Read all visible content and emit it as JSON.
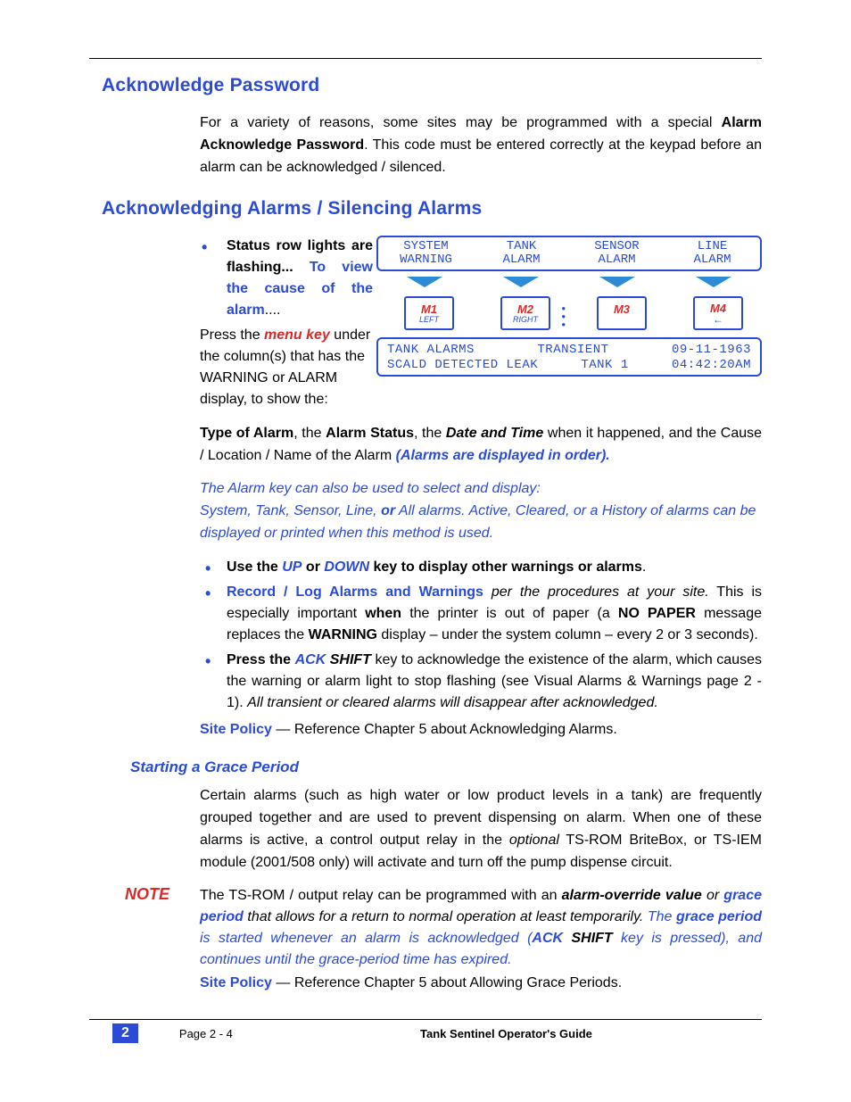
{
  "headings": {
    "h1a": "Acknowledge Password",
    "h1b": "Acknowledging Alarms / Silencing Alarms",
    "h3": "Starting a Grace Period"
  },
  "ack_password": {
    "p1_a": "For a variety of reasons, some sites may be programmed with a special ",
    "p1_b": "Alarm Acknowledge Password",
    "p1_c": ". This code must be entered correctly at the keypad before an alarm can be acknowledged / silenced."
  },
  "bullets1": {
    "b1_a": "Status row lights are flashing... ",
    "b1_b": "To view the cause of the alarm",
    "b1_c": "....",
    "tail_a": "Press the ",
    "tail_b": "menu key",
    "tail_c": " under the column(s) that has the WARNING or ALARM display, to show the:"
  },
  "keypad": {
    "status": [
      "SYSTEM WARNING",
      "TANK ALARM",
      "SENSOR ALARM",
      "LINE ALARM"
    ],
    "keys": [
      {
        "top": "M1",
        "sub": "LEFT"
      },
      {
        "top": "M2",
        "sub": "RIGHT"
      },
      {
        "top": "M3",
        "sub": ""
      },
      {
        "top": "M4",
        "sub": "←"
      }
    ],
    "lcd": {
      "l1a": "TANK ALARMS",
      "l1b": "TRANSIENT",
      "l1c": "09-11-1963",
      "l2a": "SCALD DETECTED LEAK",
      "l2b": "TANK 1",
      "l2c": "04:42:20AM"
    }
  },
  "after_keypad": {
    "p_a": "Type of Alarm",
    "p_b": ", the ",
    "p_c": "Alarm Status",
    "p_d": ", the ",
    "p_e": "Date and Time",
    "p_f": " when it happened, and the Cause / Location / Name of the Alarm ",
    "p_g": "(Alarms are displayed in order)."
  },
  "ital_note": {
    "l1": "The Alarm key can also be used to select and display:",
    "l2_a": "System, Tank, Sensor, Line, ",
    "l2_or": "or",
    "l2_b": " All alarms.  Active, Cleared, or a History of alarms can be displayed or printed when this method is used."
  },
  "bullets2": [
    {
      "a": "Use the ",
      "key1": "UP",
      "mid": " or ",
      "key2": "DOWN",
      "b": " key to display other warnings or alarms",
      "tail": "."
    },
    {
      "a": "Record / Log Alarms and Warnings",
      "b": " per the procedures at your site.",
      "c": "  This is especially important ",
      "w": "when",
      "d": " the printer is out of paper (a ",
      "np": "NO PAPER",
      "e": " message replaces the ",
      "warn": "WARNING",
      "f": " display – under the system column – every 2 or 3 seconds)."
    },
    {
      "a": "Press the ",
      "ack": "ACK",
      "shift": " SHIFT",
      "b": " key to acknowledge the existence of the alarm, which causes the warning or alarm light to stop flashing (see Visual Alarms & Warnings page 2 - 1). ",
      "c": "All transient or cleared alarms will disappear after acknowledged."
    }
  ],
  "site_policy1": {
    "lbl": "Site Policy",
    "body": " — Reference Chapter 5 about Acknowledging Alarms."
  },
  "grace": {
    "p": "Certain alarms (such as high water or low product levels in a tank) are frequently grouped together and are used to prevent dispensing on alarm. When one of these alarms is active, a control output relay in the ",
    "opt": "optional",
    "p2": " TS-ROM BriteBox, or TS-IEM module (2001/508 only) will activate and turn off the pump dispense circuit."
  },
  "note": {
    "label": "NOTE",
    "a": "The TS-ROM / output relay can be programmed with an ",
    "ov": "alarm-override value",
    "b": " or ",
    "gp": "grace period",
    "c": " that allows for a return to normal operation at least temporarily.  ",
    "d": "The ",
    "gp2": "grace period",
    "e": " is started whenever an alarm is acknowledged (",
    "ack": "ACK",
    "shift": " SHIFT",
    "f": " key is pressed), and continues until the grace-period time has expired."
  },
  "site_policy2": {
    "lbl": "Site Policy",
    "body": " — Reference Chapter 5 about Allowing Grace Periods."
  },
  "footer": {
    "chapter": "2",
    "page": "Page   2 - 4",
    "title": "Tank Sentinel Operator's Guide"
  }
}
